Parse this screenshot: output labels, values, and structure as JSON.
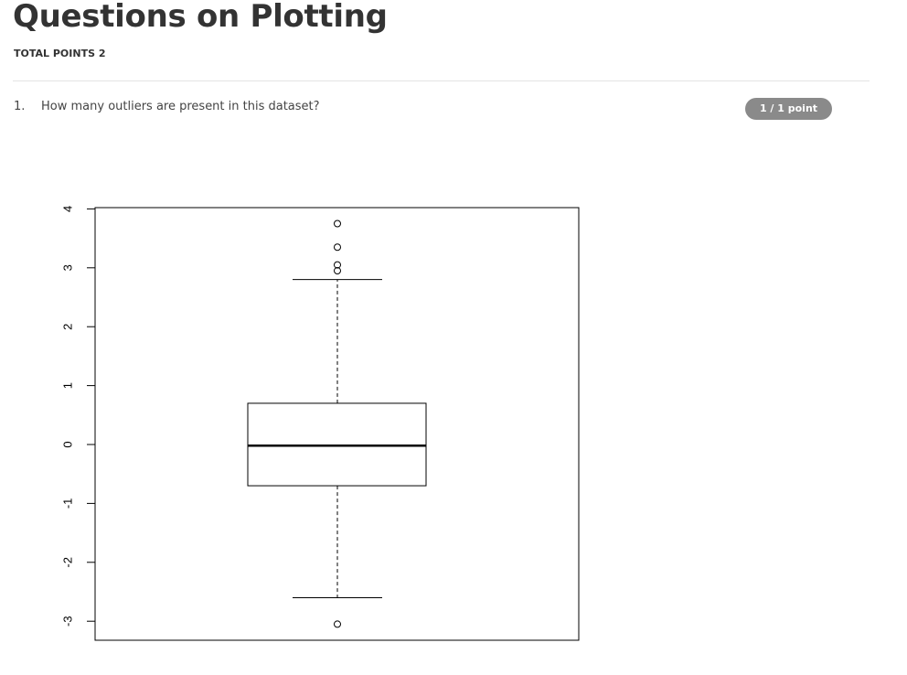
{
  "header": {
    "title": "Questions on Plotting",
    "total_points": "TOTAL POINTS 2"
  },
  "question": {
    "number": "1.",
    "text": "How many outliers are present in this dataset?",
    "score": "1 / 1 point"
  },
  "chart_data": {
    "type": "boxplot",
    "title": "",
    "xlabel": "",
    "ylabel": "",
    "ylim": [
      -3.3,
      4.05
    ],
    "yticks": [
      -3,
      -2,
      -1,
      0,
      1,
      2,
      3,
      4
    ],
    "ytick_labels": [
      "-3",
      "-2",
      "-1",
      "0",
      "1",
      "2",
      "3",
      "4"
    ],
    "grid": false,
    "box": {
      "lower_whisker": -2.6,
      "q1": -0.7,
      "median": -0.02,
      "q3": 0.7,
      "upper_whisker": 2.8
    },
    "outliers": [
      3.75,
      3.35,
      3.05,
      2.95,
      -3.05
    ]
  }
}
